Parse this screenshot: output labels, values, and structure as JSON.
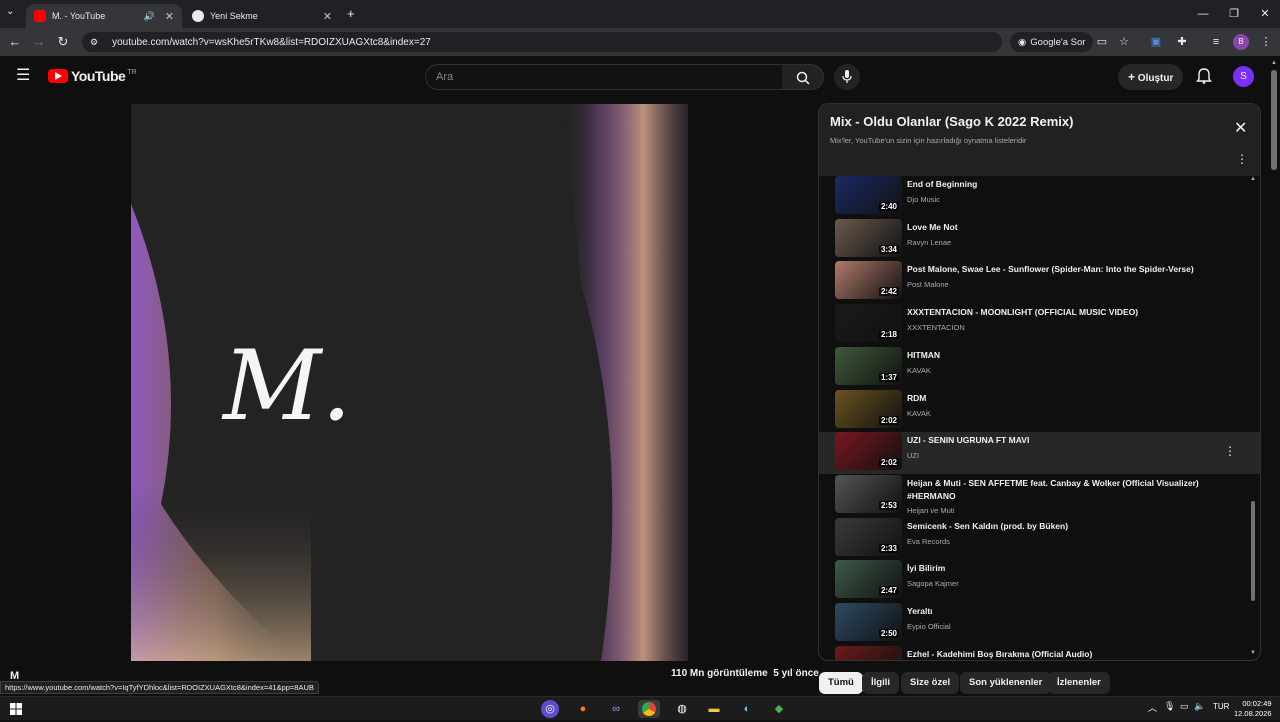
{
  "browser": {
    "tabs": [
      {
        "title": "M. - YouTube",
        "active": true
      },
      {
        "title": "Yeni Sekme",
        "active": false
      }
    ],
    "url": "youtube.com/watch?v=wsKhe5rTKw8&list=RDOIZXUAGXtc8&index=27",
    "ask_google_label": "Google'a Sor",
    "profile_initial": "B"
  },
  "youtube": {
    "logo_text": "YouTube",
    "region": "TR",
    "search_placeholder": "Ara",
    "create_label": "Oluştur",
    "avatar_initial": "S"
  },
  "video": {
    "art_text": "M.",
    "views_text": "110 Mn görüntüleme",
    "age_text": "5 yıl önce",
    "title_partial": "M"
  },
  "playlist": {
    "title": "Mix - Oldu Olanlar (Sago K 2022 Remix)",
    "subtitle": "Mix'ler, YouTube'un sizin için hazırladığı oynatma listeleridir",
    "items": [
      {
        "title": "End of Beginning",
        "channel": "Djo Music",
        "duration": "2:40",
        "thumb": "#1b2a63"
      },
      {
        "title": "Love Me Not",
        "channel": "Ravyn Lenae",
        "duration": "3:34",
        "thumb": "#6b5a4e"
      },
      {
        "title": "Post Malone, Swae Lee - Sunflower (Spider-Man: Into the Spider-Verse)",
        "channel": "Post Malone",
        "duration": "2:42",
        "thumb": "#b07a6a"
      },
      {
        "title": "XXXTENTACION - MOONLIGHT (OFFICIAL MUSIC VIDEO)",
        "channel": "XXXTENTACION",
        "duration": "2:18",
        "thumb": "#1a1a1a"
      },
      {
        "title": "HITMAN",
        "channel": "KAVAK",
        "duration": "1:37",
        "thumb": "#3f5a3a"
      },
      {
        "title": "RDM",
        "channel": "KAVAK",
        "duration": "2:02",
        "thumb": "#6a5420"
      },
      {
        "title": "UZI - SENIN UGRUNA FT MAVI",
        "channel": "UZI",
        "duration": "2:02",
        "thumb": "#7a1620"
      },
      {
        "title": "Heijan & Muti - SEN AFFETME feat. Canbay & Wolker (Official Visualizer) #HERMANO",
        "channel": "Heijan ve Muti",
        "duration": "2:53",
        "thumb": "#555555"
      },
      {
        "title": "Semicenk - Sen Kaldın (prod. by Büken)",
        "channel": "Eva Records",
        "duration": "2:33",
        "thumb": "#3a3a3a"
      },
      {
        "title": "İyi Bilirim",
        "channel": "Sagopa Kajmer",
        "duration": "2:47",
        "thumb": "#3d5a48"
      },
      {
        "title": "Yeraltı",
        "channel": "Eypio Official",
        "duration": "2:50",
        "thumb": "#2e4b63"
      },
      {
        "title": "Ezhel - Kadehimi Boş Bırakma (Official Audio)",
        "channel": "",
        "duration": "",
        "thumb": "#6a1a1a"
      }
    ]
  },
  "chips": [
    "Tümü",
    "İlgili",
    "Size özel",
    "Son yüklenenler",
    "İzlenenler"
  ],
  "status_url": "https://www.youtube.com/watch?v=IqTyfYDhloc&list=RDOIZXUAGXtc8&index=41&pp=8AUB",
  "taskbar": {
    "lang": "TUR",
    "time": "00:02:49",
    "date": "12.08.2026"
  },
  "colors": {
    "youtube_red": "#ff0000",
    "avatar": "#7b2ff7",
    "profile": "#8e44ad"
  }
}
